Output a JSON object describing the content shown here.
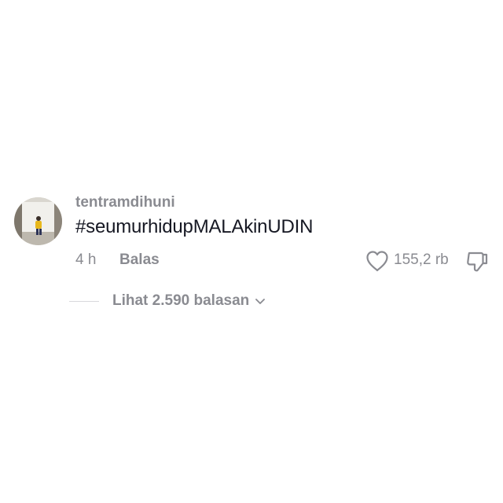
{
  "comment": {
    "username": "tentramdihuni",
    "text": "#seumurhidupMALAkinUDIN",
    "time": "4 h",
    "reply_label": "Balas",
    "like_count": "155,2 rb",
    "view_replies_label": "Lihat 2.590 balasan"
  },
  "icons": {
    "like": "heart-outline-icon",
    "dislike": "thumbs-down-icon",
    "expand": "chevron-down-icon"
  },
  "colors": {
    "primary_text": "#161823",
    "secondary_text": "#8a8b91",
    "divider": "#d8d8dc",
    "background": "#ffffff"
  }
}
